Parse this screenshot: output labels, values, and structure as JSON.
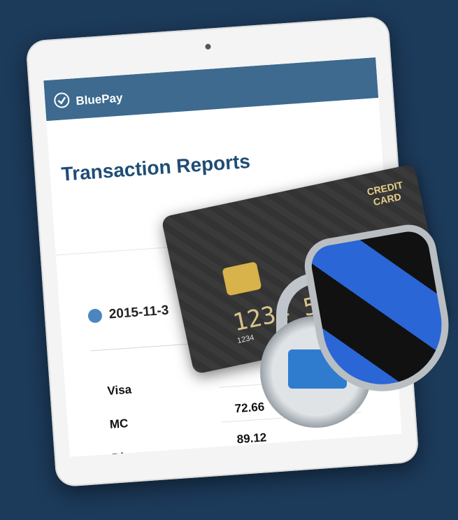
{
  "app": {
    "brand_name": "BluePay"
  },
  "page": {
    "title": "Transaction Reports"
  },
  "report": {
    "date_label": "2015-11-3",
    "rows": [
      {
        "label": "Visa",
        "value": ""
      },
      {
        "label": "MC",
        "value": "72.66"
      },
      {
        "label": "Disc",
        "value": "89.12"
      }
    ]
  },
  "art": {
    "card_label_line1": "CREDIT",
    "card_label_line2": "CARD",
    "card_number_partial": "1234 5678",
    "card_small_number": "1234",
    "colors": {
      "background": "#1c3a5a",
      "header": "#3d6a8e",
      "title": "#1f4d75"
    },
    "icons": [
      "menu-icon",
      "check-badge-icon",
      "calendar-icon",
      "credit-card-icon",
      "padlock-icon",
      "shield-icon"
    ]
  }
}
